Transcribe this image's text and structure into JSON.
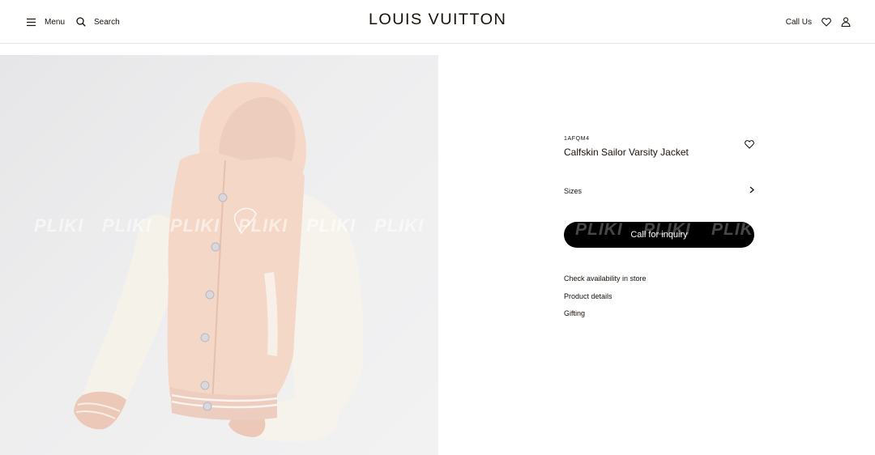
{
  "header": {
    "menu_label": "Menu",
    "search_label": "Search",
    "logo_text": "LOUIS VUITTON",
    "call_us_label": "Call Us"
  },
  "gallery": {
    "watermark_text": "PLIKI"
  },
  "product": {
    "sku": "1AFQM4",
    "name": "Calfskin Sailor Varsity Jacket",
    "sizes_label": "Sizes",
    "cta_label": "Call for inquiry",
    "cta_watermark": "PLIKI",
    "links": [
      "Check availability in store",
      "Product details",
      "Gifting"
    ]
  },
  "colors": {
    "text": "#19110b",
    "cta_background": "#000000",
    "jacket_body": "#f4d7c7",
    "jacket_sleeves": "#f6f3ec"
  }
}
